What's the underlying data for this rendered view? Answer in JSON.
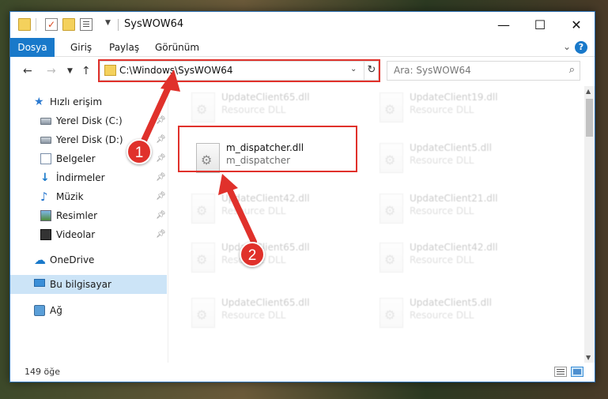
{
  "window": {
    "title": "SysWOW64"
  },
  "ribbon": {
    "tabs": [
      "Dosya",
      "Giriş",
      "Paylaş",
      "Görünüm"
    ]
  },
  "address": {
    "path": "C:\\Windows\\SysWOW64"
  },
  "search": {
    "placeholder": "Ara: SysWOW64"
  },
  "sidebar": {
    "items": [
      {
        "label": "Hızlı erişim",
        "icon": "star-icon"
      },
      {
        "label": "Yerel Disk (C:)",
        "icon": "disk-icon",
        "pinned": true
      },
      {
        "label": "Yerel Disk (D:)",
        "icon": "disk-icon",
        "pinned": true
      },
      {
        "label": "Belgeler",
        "icon": "documents-icon",
        "pinned": true
      },
      {
        "label": "İndirmeler",
        "icon": "downloads-icon",
        "pinned": true
      },
      {
        "label": "Müzik",
        "icon": "music-icon",
        "pinned": true
      },
      {
        "label": "Resimler",
        "icon": "pictures-icon",
        "pinned": true
      },
      {
        "label": "Videolar",
        "icon": "videos-icon",
        "pinned": true
      },
      {
        "label": "OneDrive",
        "icon": "onedrive-icon"
      },
      {
        "label": "Bu bilgisayar",
        "icon": "this-pc-icon",
        "selected": true
      },
      {
        "label": "Ağ",
        "icon": "network-icon"
      }
    ]
  },
  "files": [
    {
      "name": "UpdateClient65.dll",
      "type": "Resource DLL"
    },
    {
      "name": "UpdateClient19.dll",
      "type": "Resource DLL"
    },
    {
      "name": "m_dispatcher.dll",
      "type": "m_dispatcher"
    },
    {
      "name": "UpdateClient5.dll",
      "type": "Resource DLL"
    },
    {
      "name": "UpdateClient42.dll",
      "type": "Resource DLL"
    },
    {
      "name": "UpdateClient21.dll",
      "type": "Resource DLL"
    },
    {
      "name": "UpdateClient65.dll",
      "type": "Resource DLL"
    },
    {
      "name": "UpdateClient42.dll",
      "type": "Resource DLL"
    },
    {
      "name": "UpdateClient65.dll",
      "type": "Resource DLL"
    },
    {
      "name": "UpdateClient5.dll",
      "type": "Resource DLL"
    }
  ],
  "status": {
    "count": "149 öğe"
  },
  "callouts": {
    "one": "1",
    "two": "2"
  },
  "colors": {
    "highlight": "#e0312b",
    "accent": "#1979ca"
  }
}
